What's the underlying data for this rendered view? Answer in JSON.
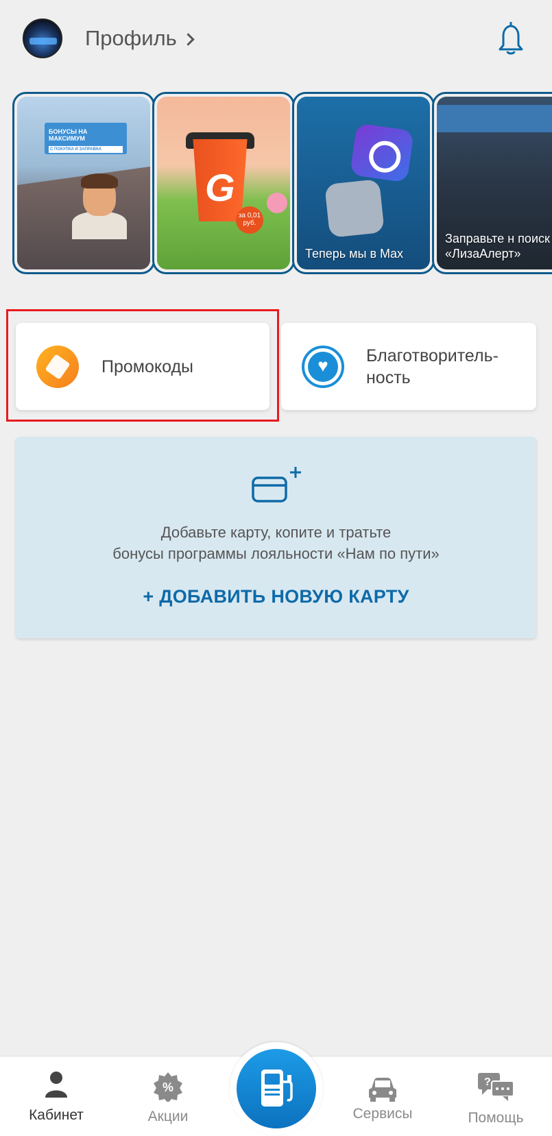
{
  "header": {
    "profile_label": "Профиль"
  },
  "stories": [
    {
      "id": "bonus",
      "text": "",
      "board_title": "БОНУСЫ НА МАКСИМУМ",
      "board_sub": "С ПОКУПКА И ЗАПРАВКА"
    },
    {
      "id": "coffee",
      "text": "",
      "cup_letter": "G",
      "badge": "за 0,01 руб."
    },
    {
      "id": "max",
      "text": "Теперь мы в Max"
    },
    {
      "id": "liza",
      "text": "Заправьте н поиск «ЛизаАлерт»"
    }
  ],
  "actions": {
    "promo_label": "Промокоды",
    "charity_label_line1": "Благотворитель-",
    "charity_label_line2": "ность"
  },
  "add_card": {
    "desc_line1": "Добавьте карту, копите и тратьте",
    "desc_line2": "бонусы программы лояльности «Нам по пути»",
    "button_label": "+ ДОБАВИТЬ НОВУЮ КАРТУ"
  },
  "bottom_nav": {
    "cabinet": "Кабинет",
    "promotions": "Акции",
    "promotions_icon_glyph": "%",
    "services": "Сервисы",
    "help": "Помощь"
  },
  "colors": {
    "accent": "#0e6aa8",
    "highlight": "#e8191f",
    "story_border": "#0e5a8c"
  }
}
